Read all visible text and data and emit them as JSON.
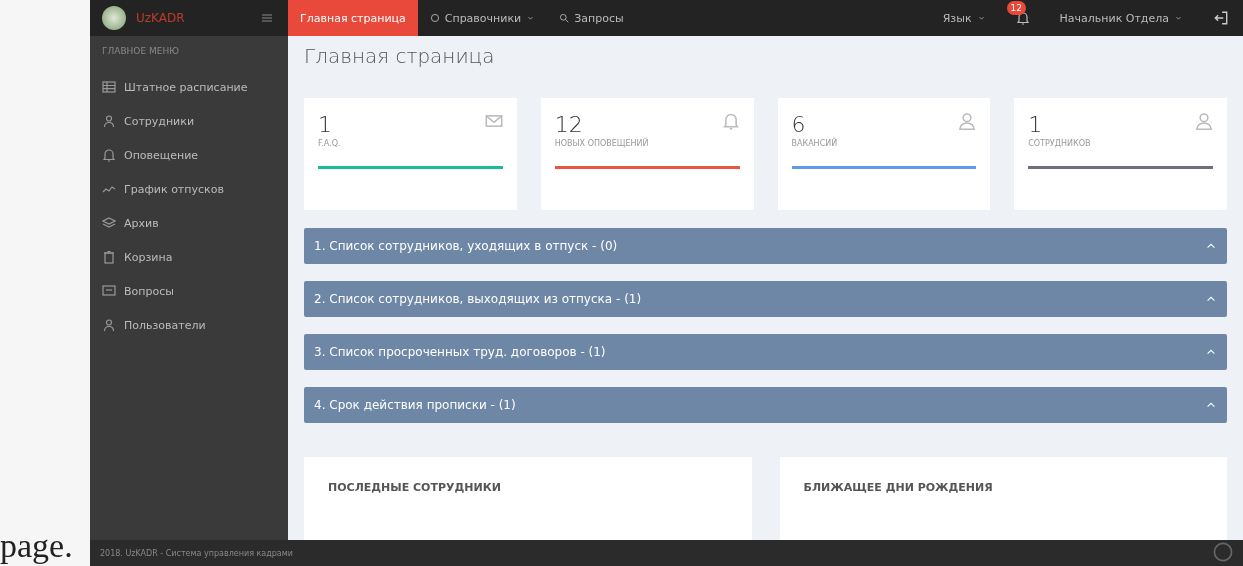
{
  "outer_text": "page.",
  "topbar": {
    "logo_text": "UzKADR",
    "nav": [
      {
        "label": "Главная страница",
        "selected": true
      },
      {
        "label": "Справочники",
        "selected": false
      },
      {
        "label": "Запросы",
        "selected": false
      }
    ],
    "language": "Язык",
    "notification_badge": "12",
    "user": "Начальник Отдела"
  },
  "sidebar": {
    "title": "ГЛАВНОЕ МЕНЮ",
    "items": [
      {
        "label": "Штатное расписание"
      },
      {
        "label": "Сотрудники"
      },
      {
        "label": "Оповещение"
      },
      {
        "label": "График отпусков"
      },
      {
        "label": "Архив"
      },
      {
        "label": "Корзина"
      },
      {
        "label": "Вопросы"
      },
      {
        "label": "Пользователи"
      }
    ]
  },
  "page_title": "Главная страница",
  "stats": [
    {
      "value": "1",
      "label": "F.A.Q.",
      "color": "#1abc9c"
    },
    {
      "value": "12",
      "label": "НОВЫХ ОПОВЕЩЕНИЙ",
      "color": "#e9573f"
    },
    {
      "value": "6",
      "label": "ВАКАНСИЙ",
      "color": "#5d9cec"
    },
    {
      "value": "1",
      "label": "СОТРУДНИКОВ",
      "color": "#6d6e7e"
    }
  ],
  "panels": [
    {
      "title": "1. Список сотрудников, уходящих в отпуск - (0)"
    },
    {
      "title": "2. Список сотрудников, выходящих из отпуска - (1)"
    },
    {
      "title": "3. Список просроченных труд. договоров - (1)"
    },
    {
      "title": "4. Срок действия прописки - (1)"
    }
  ],
  "widgets": [
    {
      "title": "ПОСЛЕДНЫЕ СОТРУДНИКИ"
    },
    {
      "title": "БЛИЖАЩЕЕ ДНИ РОЖДЕНИЯ"
    }
  ],
  "footer": "2018. UzKADR - Система управления кадрами"
}
